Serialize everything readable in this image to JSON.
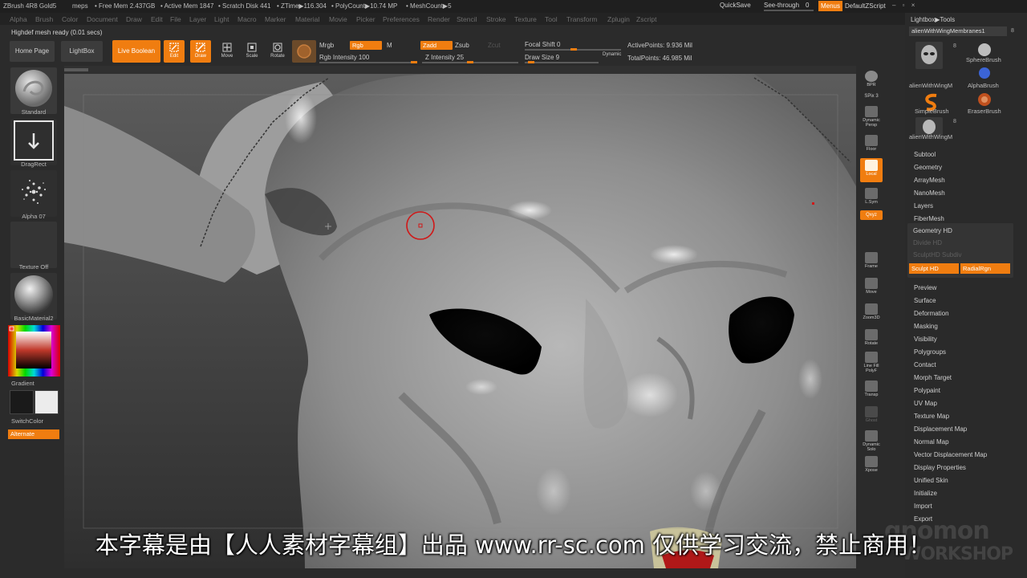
{
  "titlebar": {
    "app": "ZBrush 4R8 Gold5",
    "project": "meps",
    "free_mem": "• Free Mem 2.437GB",
    "active_mem": "• Active Mem 1847",
    "scratch_disk": "• Scratch Disk 441",
    "ztime": "• ZTime▶116.304",
    "polycount": "• PolyCount▶10.74 MP",
    "meshcount": "• MeshCount▶5",
    "quicksave": "QuickSave",
    "see_through_label": "See-through",
    "see_through_value": "0",
    "menus": "Menus",
    "default_script": "DefaultZScript",
    "window_controls": "– ▫ ×"
  },
  "menubar": [
    "Alpha",
    "Brush",
    "Color",
    "Document",
    "Draw",
    "Edit",
    "File",
    "Layer",
    "Light",
    "Macro",
    "Marker",
    "Material",
    "Movie",
    "Picker",
    "Preferences",
    "Render",
    "Stencil",
    "Stroke",
    "Texture",
    "Tool",
    "Transform",
    "Zplugin",
    "Zscript"
  ],
  "status": "Highdef mesh ready (0.01 secs)",
  "shelf": {
    "home_page": "Home Page",
    "lightbox": "LightBox",
    "live_boolean": "Live Boolean",
    "edit": "Edit",
    "draw": "Draw",
    "move": "Move",
    "scale": "Scale",
    "rotate": "Rotate",
    "mrgb": "Mrgb",
    "rgb": "Rgb",
    "m": "M",
    "zadd": "Zadd",
    "zsub": "Zsub",
    "zcut": "Zcut",
    "rgb_intensity": "Rgb Intensity 100",
    "z_intensity": "Z Intensity 25",
    "focal_shift": "Focal Shift 0",
    "draw_size": "Draw Size 9",
    "dynamic": "Dynamic",
    "active_points": "ActivePoints: 9.936 Mil",
    "total_points": "TotalPoints: 46.985 Mil"
  },
  "left_tray": {
    "brush": "Standard",
    "stroke": "DragRect",
    "alpha": "Alpha 07",
    "texture": "Texture Off",
    "material": "BasicMaterial2",
    "gradient": "Gradient",
    "switch_color": "SwitchColor",
    "alternate": "Alternate"
  },
  "right_shelf": [
    "BPR",
    "SPix 3",
    "Dynamic Persp",
    "Floor",
    "Local",
    "L.Sym",
    "Qxyz",
    "Frame",
    "Move",
    "Zoom3D",
    "Rotate",
    "Line Fill PolyF",
    "Transp",
    "Ghost",
    "Dynamic Solo",
    "Xpose"
  ],
  "tool_panel": {
    "header": "Lightbox▶Tools",
    "current_tool": "alienWithWingMembranes1",
    "current_tool_count": "8",
    "thumbs": [
      {
        "label": "alienWithWingM",
        "count": "8"
      },
      {
        "label": "SphereBrush",
        "count": ""
      },
      {
        "label": "AlphaBrush",
        "count": ""
      },
      {
        "label": "SimpleBrush",
        "count": ""
      },
      {
        "label": "EraserBrush",
        "count": ""
      },
      {
        "label": "alienWithWingM",
        "count": "8"
      }
    ],
    "subtool": "Subtool",
    "geometry": "Geometry",
    "arraymesh": "ArrayMesh",
    "nanomesh": "NanoMesh",
    "layers": "Layers",
    "fibermesh": "FiberMesh",
    "geometry_hd": "Geometry HD",
    "divide_hd": "Divide HD",
    "sculpt_hd_subdiv": "SculptHD Subdiv",
    "sculpt_hd": "Sculpt HD",
    "radial_rgn": "RadialRgn",
    "items": [
      "Preview",
      "Surface",
      "Deformation",
      "Masking",
      "Visibility",
      "Polygroups",
      "Contact",
      "Morph Target",
      "Polypaint",
      "UV Map",
      "Texture Map",
      "Displacement Map",
      "Normal Map",
      "Vector Displacement Map",
      "Display Properties",
      "Unified Skin",
      "Initialize",
      "Import",
      "Export"
    ]
  },
  "subtitle": "本字幕是由【人人素材字幕组】出品 www.rr-sc.com 仅供学习交流，禁止商用！",
  "watermark": {
    "line1": "gnomon",
    "line2": "WORKSHOP"
  },
  "colors": {
    "accent": "#f07d10",
    "panel": "#2b2b2b"
  }
}
